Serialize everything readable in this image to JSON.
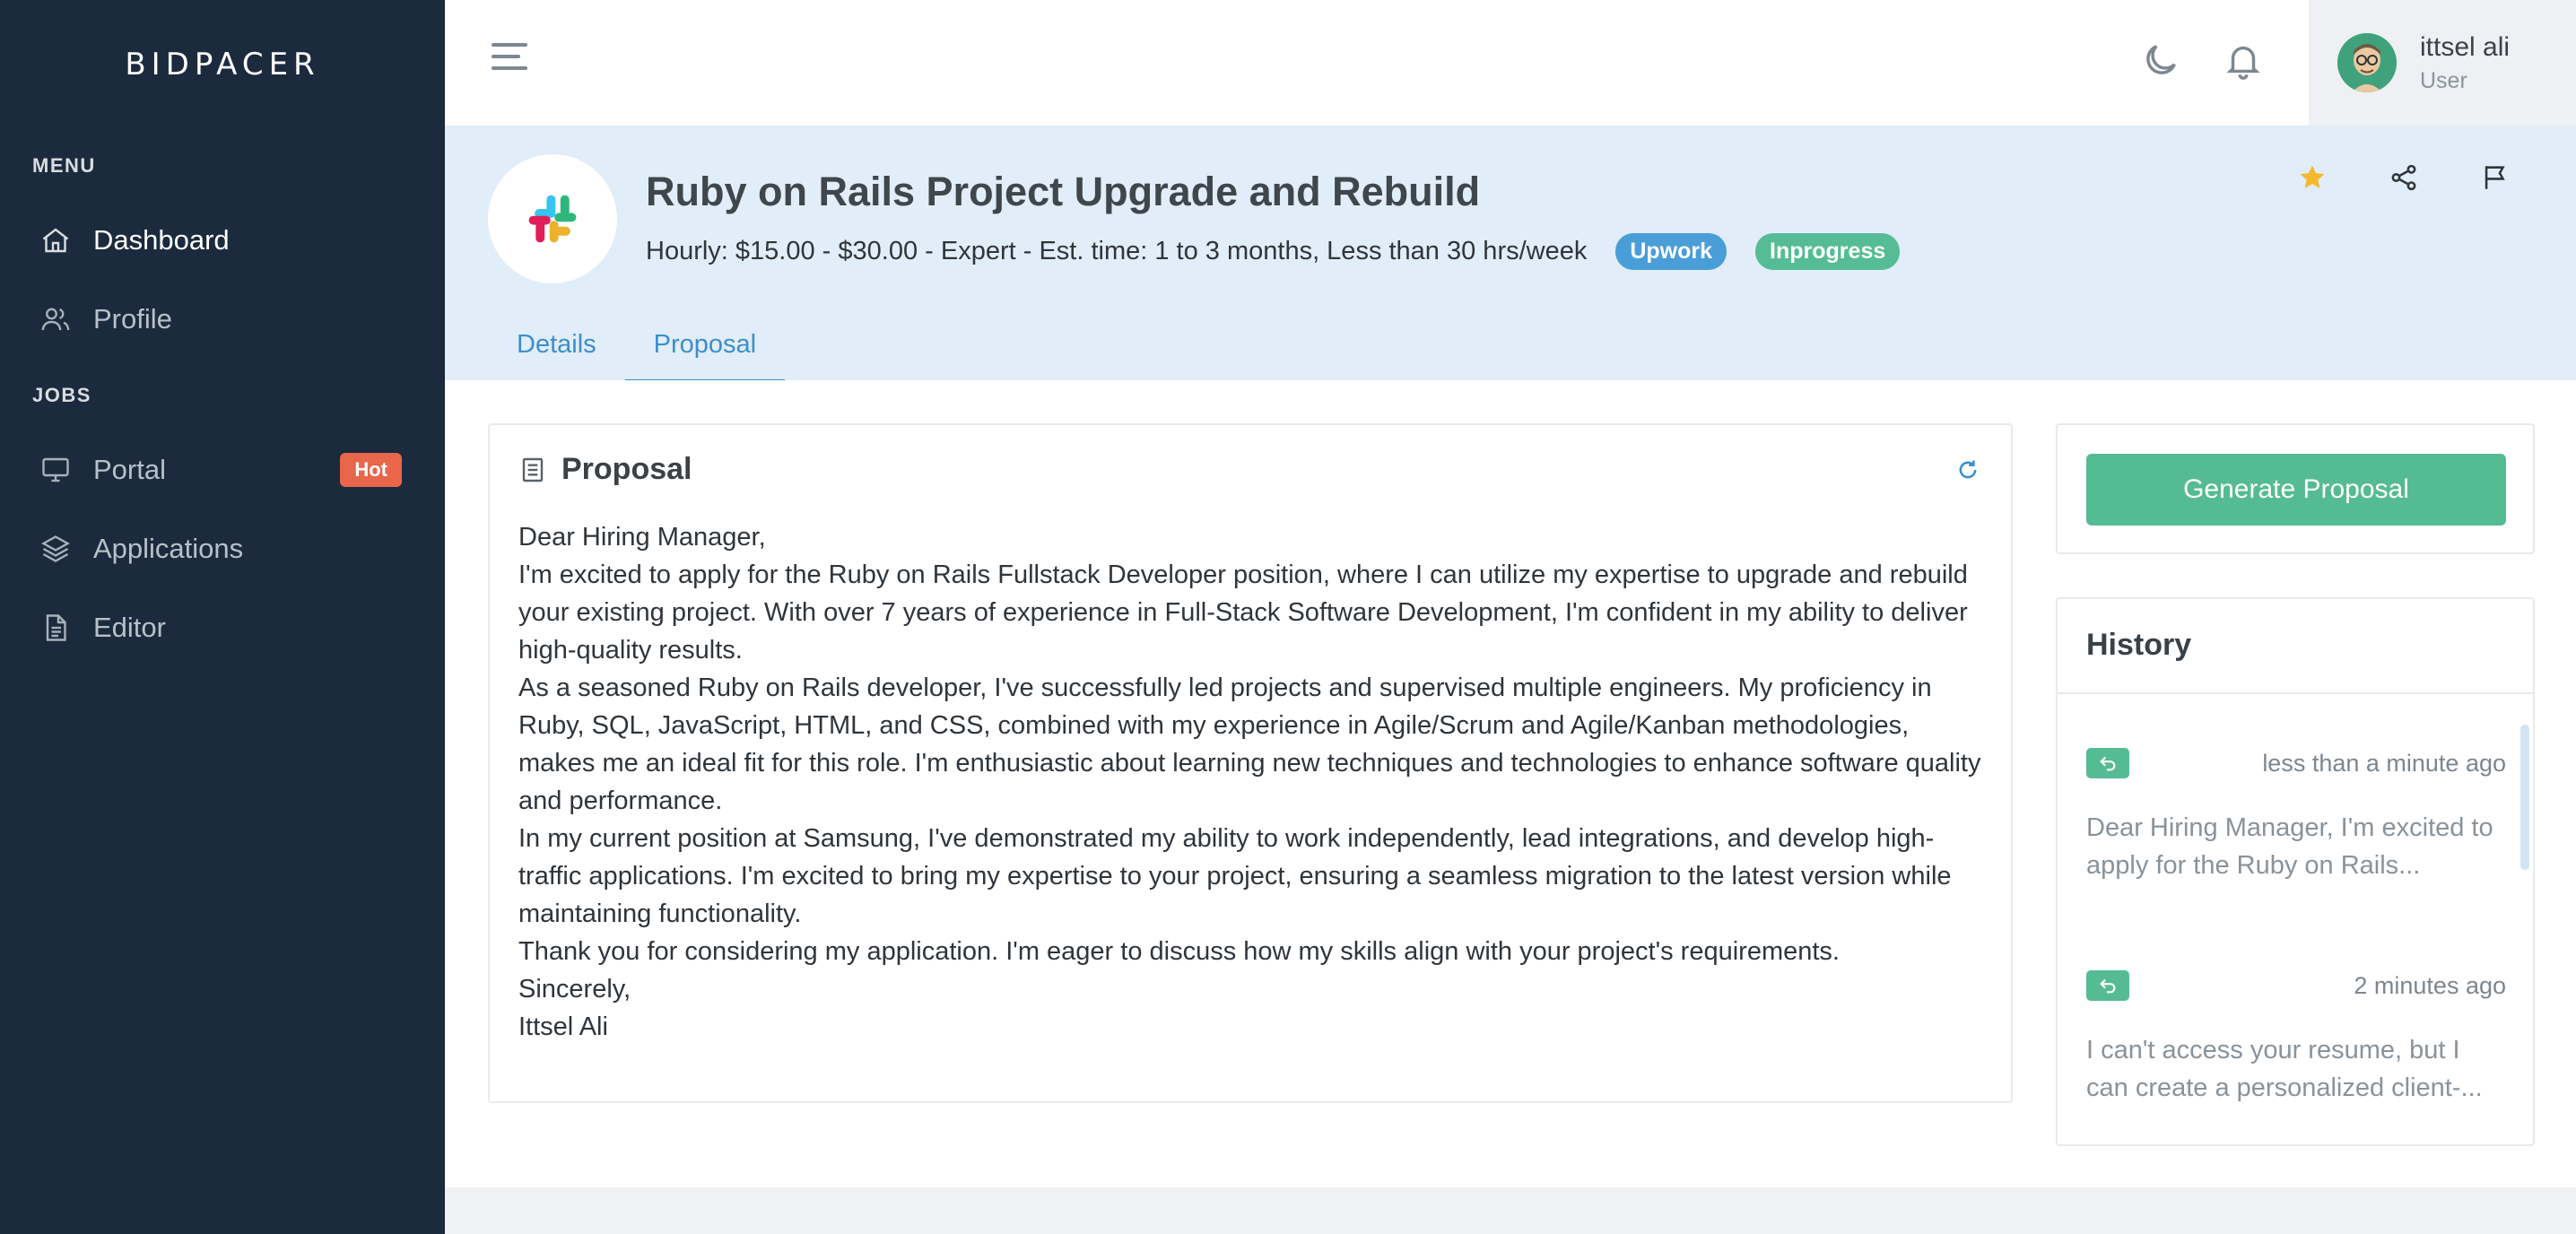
{
  "sidebar": {
    "logo": "BIDPACER",
    "menu_title": "MENU",
    "jobs_title": "JOBS",
    "items": [
      {
        "label": "Dashboard",
        "icon": "home-icon"
      },
      {
        "label": "Profile",
        "icon": "users-icon"
      },
      {
        "label": "Portal",
        "icon": "monitor-icon",
        "badge": "Hot"
      },
      {
        "label": "Applications",
        "icon": "layers-icon"
      },
      {
        "label": "Editor",
        "icon": "document-icon"
      }
    ]
  },
  "user": {
    "name": "ittsel ali",
    "role": "User"
  },
  "job": {
    "title": "Ruby on Rails Project Upgrade and Rebuild",
    "meta": "Hourly: $15.00 - $30.00 - Expert - Est. time: 1 to 3 months, Less than 30 hrs/week",
    "platform": "Upwork",
    "status": "Inprogress",
    "tabs": [
      "Details",
      "Proposal"
    ],
    "active_tab": "Proposal"
  },
  "proposal": {
    "title": "Proposal",
    "paragraphs": [
      "Dear Hiring Manager,",
      "I'm excited to apply for the Ruby on Rails Fullstack Developer position, where I can utilize my expertise to upgrade and rebuild your existing project. With over 7 years of experience in Full-Stack Software Development, I'm confident in my ability to deliver high-quality results.",
      "As a seasoned Ruby on Rails developer, I've successfully led projects and supervised multiple engineers. My proficiency in Ruby, SQL, JavaScript, HTML, and CSS, combined with my experience in Agile/Scrum and Agile/Kanban methodologies, makes me an ideal fit for this role. I'm enthusiastic about learning new techniques and technologies to enhance software quality and performance.",
      "In my current position at Samsung, I've demonstrated my ability to work independently, lead integrations, and develop high-traffic applications. I'm excited to bring my expertise to your project, ensuring a seamless migration to the latest version while maintaining functionality.",
      "Thank you for considering my application. I'm eager to discuss how my skills align with your project's requirements.",
      "Sincerely,",
      "Ittsel Ali"
    ]
  },
  "generate_label": "Generate Proposal",
  "history": {
    "title": "History",
    "items": [
      {
        "time": "less than a minute ago",
        "preview": "Dear Hiring Manager, I'm excited to apply for the Ruby on Rails..."
      },
      {
        "time": "2 minutes ago",
        "preview": "I can't access your resume, but I can create a personalized client-..."
      }
    ]
  },
  "colors": {
    "sidebar_bg": "#1b2b3d",
    "accent_green": "#55bb95",
    "accent_blue": "#3c8fcc",
    "hot_badge": "#e8664a",
    "star": "#f4b92e"
  }
}
